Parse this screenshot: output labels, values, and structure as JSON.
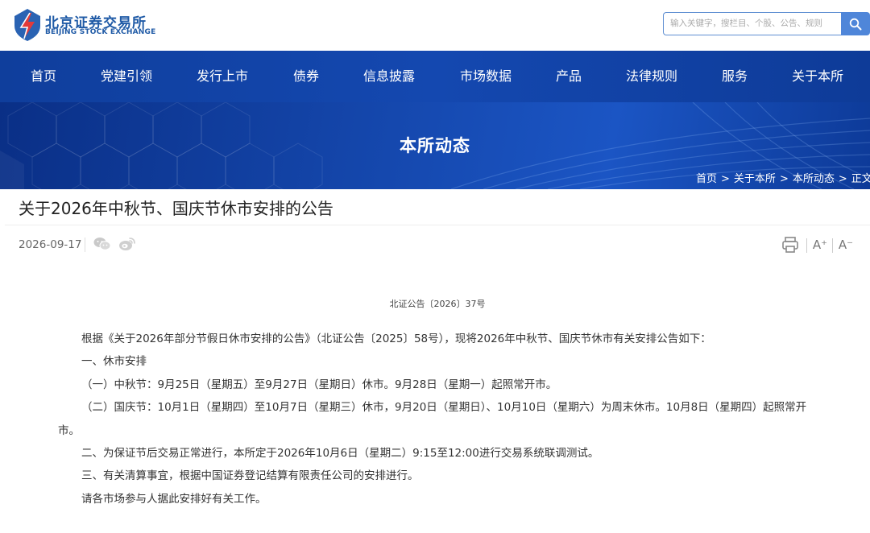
{
  "header": {
    "logo_cn": "北京证券交易所",
    "logo_en": "BEIJING STOCK EXCHANGE",
    "search_placeholder": "输入关键字，搜栏目、个股、公告、规则",
    "colors": {
      "brand_blue": "#1f5aa6",
      "brand_red": "#e23a3a",
      "search_button": "#4f86d9"
    }
  },
  "nav": {
    "items": [
      {
        "label": "首页"
      },
      {
        "label": "党建引领"
      },
      {
        "label": "发行上市"
      },
      {
        "label": "债券"
      },
      {
        "label": "信息披露"
      },
      {
        "label": "市场数据"
      },
      {
        "label": "产品"
      },
      {
        "label": "法律规则"
      },
      {
        "label": "服务"
      },
      {
        "label": "关于本所"
      }
    ],
    "background": "#1448b0"
  },
  "banner": {
    "title": "本所动态",
    "breadcrumb": [
      "首页",
      ">",
      "关于本所",
      ">",
      "本所动态",
      ">",
      "正文"
    ]
  },
  "article": {
    "title": "关于2026年中秋节、国庆节休市安排的公告",
    "date": "2026-09-17",
    "share_icons": [
      "wechat-icon",
      "weibo-icon"
    ],
    "tools": {
      "increase_font": "A⁺",
      "decrease_font": "A⁻",
      "print_icon": "print-icon"
    },
    "doc_number": "北证公告〔2026〕37号",
    "paragraphs": [
      "根据《关于2026年部分节假日休市安排的公告》（北证公告〔2025〕58号），现将2026年中秋节、国庆节休市有关安排公告如下：",
      "一、休市安排",
      "（一）中秋节：9月25日（星期五）至9月27日（星期日）休市。9月28日（星期一）起照常开市。",
      "（二）国庆节：10月1日（星期四）至10月7日（星期三）休市，9月20日（星期日）、10月10日（星期六）为周末休市。10月8日（星期四）起照常开市。",
      "二、为保证节后交易正常进行，本所定于2026年10月6日（星期二）9:15至12:00进行交易系统联调测试。",
      "三、有关清算事宜，根据中国证券登记结算有限责任公司的安排进行。",
      "请各市场参与人据此安排好有关工作。"
    ]
  }
}
